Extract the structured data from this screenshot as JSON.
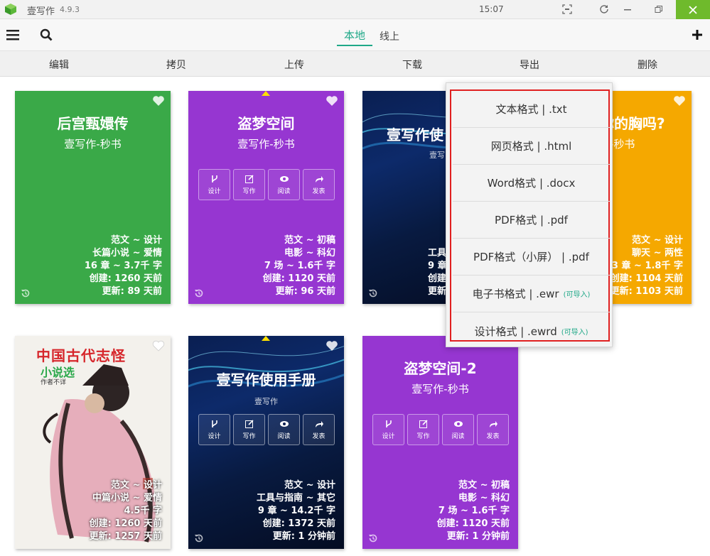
{
  "app": {
    "name": "壹写作",
    "version": "4.9.3",
    "clock": "15:07"
  },
  "toolbar": {
    "tabs": [
      {
        "label": "本地",
        "active": true
      },
      {
        "label": "线上",
        "active": false
      }
    ]
  },
  "actions": [
    {
      "label": "编辑"
    },
    {
      "label": "拷贝"
    },
    {
      "label": "上传"
    },
    {
      "label": "下载"
    },
    {
      "label": "导出"
    },
    {
      "label": "删除"
    }
  ],
  "card_buttons": {
    "design": "设计",
    "write": "写作",
    "read": "阅读",
    "publish": "发表"
  },
  "cards": [
    {
      "title": "后宫甄嬛传",
      "subtitle": "壹写作-秒书",
      "lines": [
        "范文 ~ 设计",
        "长篇小说 ~ 爱情",
        "16 章 ~ 3.7千 字",
        "创建: 1260 天前",
        "更新: 89 天前"
      ]
    },
    {
      "title": "盗梦空间",
      "subtitle": "壹写作-秒书",
      "lines": [
        "范文 ~ 初稿",
        "电影 ~ 科幻",
        "7 场 ~ 1.6千 字",
        "创建: 1120 天前",
        "更新: 96 天前"
      ]
    },
    {
      "title": "壹写作使",
      "subtitle": "壹写",
      "lines": [
        "工具",
        "9 章",
        "创建",
        "更新"
      ]
    },
    {
      "title": "你的胸吗?",
      "subtitle": "-秒书",
      "lines": [
        "范文 ~ 设计",
        "聊天 ~ 两性",
        "3 章 ~ 1.8千 字",
        "创建: 1104 天前",
        "更新: 1103 天前"
      ]
    },
    {
      "title1": "中国古代志怪",
      "title2": "小说选",
      "author": "作者不详",
      "lines": [
        "范文 ~ 设计",
        "中篇小说 ~ 爱情",
        "4.5千 字",
        "创建: 1260 天前",
        "更新: 1257 天前"
      ]
    },
    {
      "title": "壹写作使用手册",
      "subtitle": "壹写作",
      "lines": [
        "范文 ~ 设计",
        "工具与指南 ~ 其它",
        "9 章 ~ 14.2千 字",
        "创建: 1372 天前",
        "更新: 1 分钟前"
      ]
    },
    {
      "title": "盗梦空间-2",
      "subtitle": "壹写作-秒书",
      "lines": [
        "范文 ~ 初稿",
        "电影 ~ 科幻",
        "7 场 ~ 1.6千 字",
        "创建: 1120 天前",
        "更新: 1 分钟前"
      ]
    }
  ],
  "export_menu": {
    "items": [
      {
        "label": "文本格式 | .txt",
        "tag": ""
      },
      {
        "label": "网页格式 | .html",
        "tag": ""
      },
      {
        "label": "Word格式 | .docx",
        "tag": ""
      },
      {
        "label": "PDF格式 | .pdf",
        "tag": ""
      },
      {
        "label": "PDF格式（小屏） | .pdf",
        "tag": ""
      },
      {
        "label": "电子书格式 | .ewr",
        "tag": "(可导入)"
      },
      {
        "label": "设计格式 | .ewrd",
        "tag": "(可导入)"
      }
    ]
  },
  "colors": {
    "accent": "#1fa888",
    "green_card": "#3aa948",
    "purple_card": "#9636d1",
    "orange_card": "#f5a800",
    "highlight": "#e02020"
  },
  "icons": [
    "app-logo-icon",
    "menu-icon",
    "search-icon",
    "plus-icon",
    "heart-icon",
    "history-icon",
    "design-icon",
    "write-icon",
    "read-icon",
    "publish-icon"
  ]
}
